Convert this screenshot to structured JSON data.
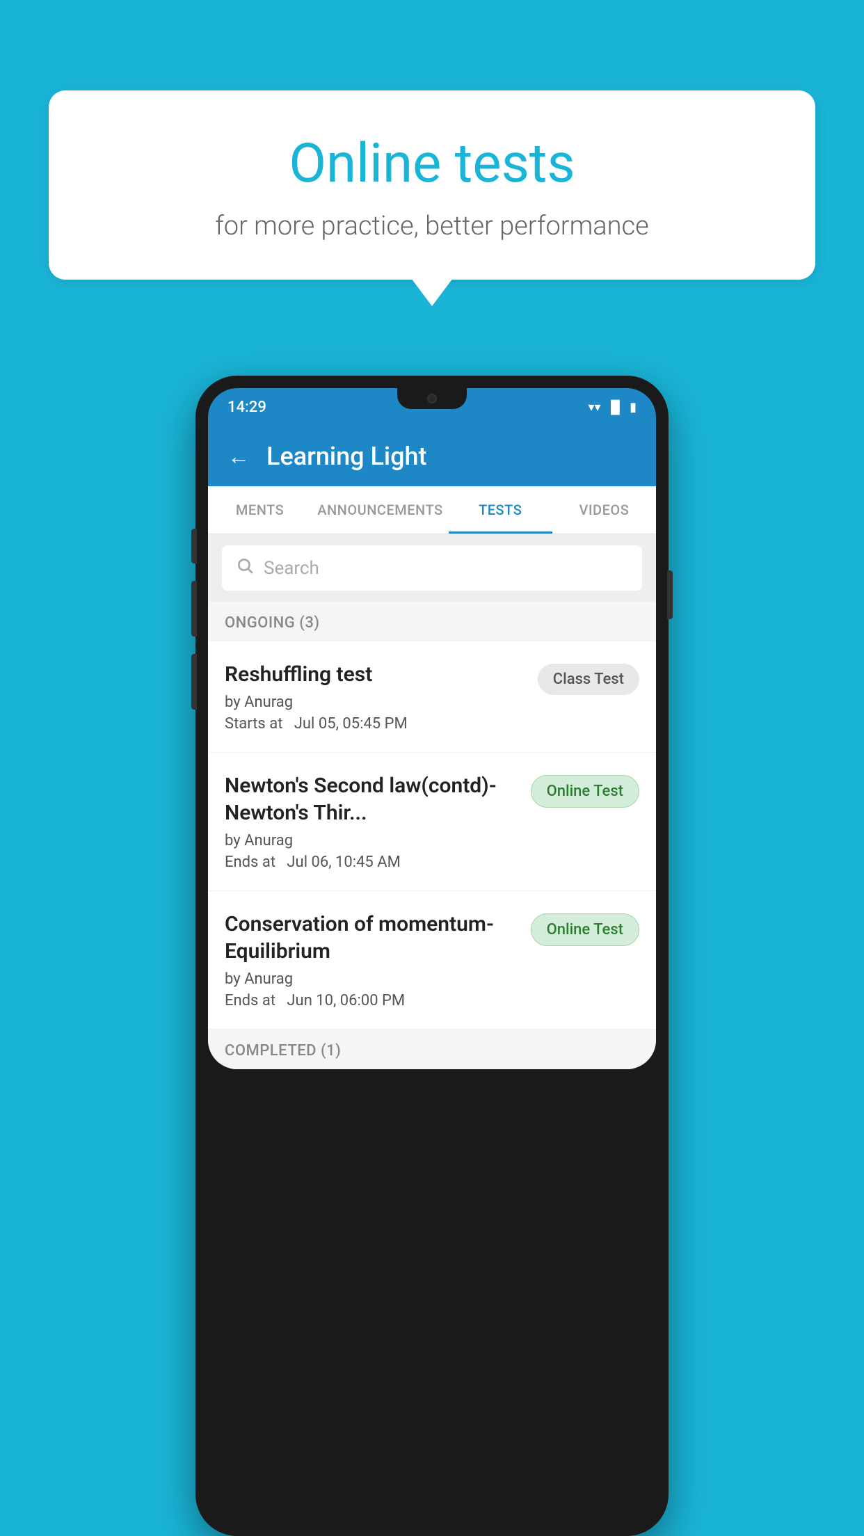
{
  "background_color": "#1ab4d7",
  "speech_bubble": {
    "title": "Online tests",
    "subtitle": "for more practice, better performance"
  },
  "phone": {
    "status_bar": {
      "time": "14:29",
      "icons": [
        "wifi",
        "signal",
        "battery"
      ]
    },
    "app_header": {
      "back_label": "←",
      "title": "Learning Light"
    },
    "tabs": [
      {
        "label": "MENTS",
        "active": false
      },
      {
        "label": "ANNOUNCEMENTS",
        "active": false
      },
      {
        "label": "TESTS",
        "active": true
      },
      {
        "label": "VIDEOS",
        "active": false
      }
    ],
    "search": {
      "placeholder": "Search"
    },
    "ongoing_section": {
      "label": "ONGOING (3)"
    },
    "tests": [
      {
        "name": "Reshuffling test",
        "author": "by Anurag",
        "time_label": "Starts at",
        "time": "Jul 05, 05:45 PM",
        "badge": "Class Test",
        "badge_type": "class"
      },
      {
        "name": "Newton's Second law(contd)-Newton's Thir...",
        "author": "by Anurag",
        "time_label": "Ends at",
        "time": "Jul 06, 10:45 AM",
        "badge": "Online Test",
        "badge_type": "online"
      },
      {
        "name": "Conservation of momentum-Equilibrium",
        "author": "by Anurag",
        "time_label": "Ends at",
        "time": "Jun 10, 06:00 PM",
        "badge": "Online Test",
        "badge_type": "online"
      }
    ],
    "completed_section": {
      "label": "COMPLETED (1)"
    }
  }
}
